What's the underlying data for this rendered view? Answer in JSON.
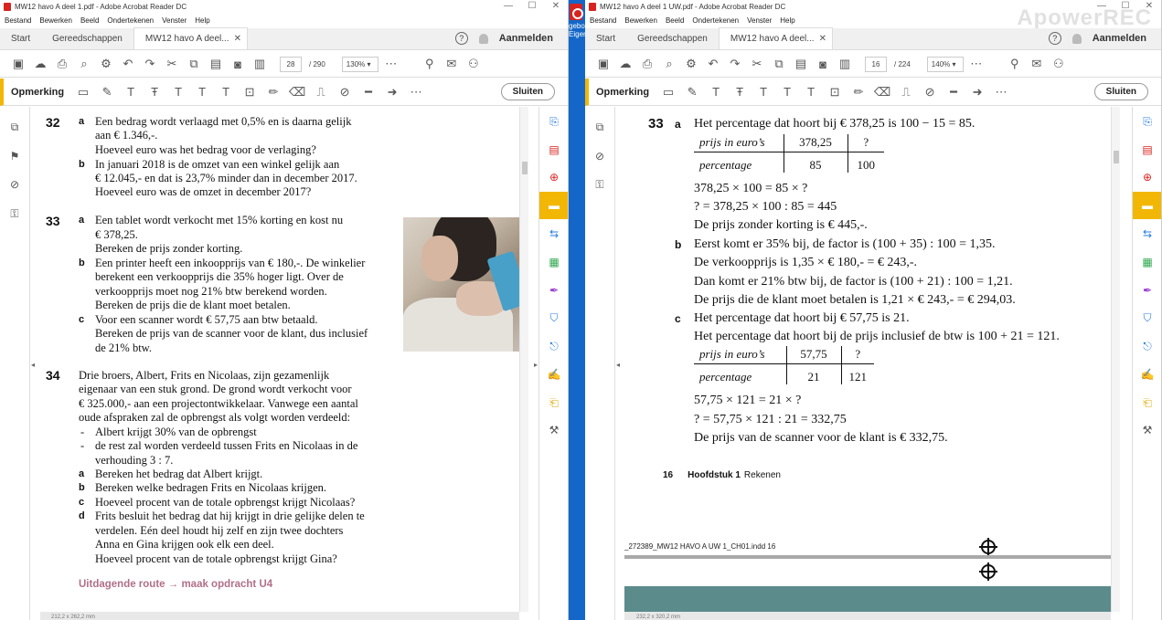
{
  "left": {
    "title": "MW12 havo A deel 1.pdf - Adobe Acrobat Reader DC",
    "menu": [
      "Bestand",
      "Bewerken",
      "Beeld",
      "Ondertekenen",
      "Venster",
      "Help"
    ],
    "tabs": {
      "start": "Start",
      "tools": "Gereedschappen",
      "doc": "MW12 havo A deel..."
    },
    "signin": "Aanmelden",
    "page_current": "28",
    "page_total": "/ 290",
    "zoom": "130%",
    "annot_label": "Opmerking",
    "close_label": "Sluiten",
    "status": "212,2 x 262,2 mm",
    "q32": {
      "num": "32",
      "a": [
        "Een bedrag wordt verlaagd met 0,5% en is daarna gelijk",
        "aan € 1.346,-.",
        "Hoeveel euro was het bedrag voor de verlaging?"
      ],
      "b": [
        "In januari 2018 is de omzet van een winkel gelijk aan",
        "€ 12.045,- en dat is 23,7% minder dan in december 2017.",
        "Hoeveel euro was de omzet in december 2017?"
      ]
    },
    "q33": {
      "num": "33",
      "a": [
        "Een tablet wordt verkocht met 15% korting en kost nu",
        "€ 378,25.",
        "Bereken de prijs zonder korting."
      ],
      "b": [
        "Een printer heeft een inkoopprijs van € 180,-. De winkelier",
        "berekent een verkoopprijs die 35% hoger ligt. Over de",
        "verkoopprijs moet nog 21% btw berekend worden.",
        "Bereken de prijs die de klant moet betalen."
      ],
      "c": [
        "Voor een scanner wordt € 57,75 aan btw betaald.",
        "Bereken de prijs van de scanner voor de klant, dus inclusief",
        "de 21% btw."
      ]
    },
    "q34": {
      "num": "34",
      "intro": [
        "Drie broers, Albert, Frits en Nicolaas, zijn gezamenlijk",
        "eigenaar van een stuk grond. De grond wordt verkocht voor",
        "€ 325.000,- aan een projectontwikkelaar. Vanwege een aantal",
        "oude afspraken zal de opbrengst als volgt worden verdeeld:"
      ],
      "bullets": [
        "Albert krijgt 30% van de opbrengst",
        "de rest zal worden verdeeld tussen Frits en Nicolaas in de",
        "verhouding 3 : 7."
      ],
      "a": "Bereken het bedrag dat Albert krijgt.",
      "b": "Bereken welke bedragen Frits en Nicolaas krijgen.",
      "c": "Hoeveel procent van de totale opbrengst krijgt Nicolaas?",
      "d": [
        "Frits besluit het bedrag dat hij krijgt in drie gelijke delen te",
        "verdelen. Eén deel houdt hij zelf en zijn twee dochters",
        "Anna en Gina krijgen ook elk een deel.",
        "Hoeveel procent van de totale opbrengst krijgt Gina?"
      ]
    },
    "route": "Uitdagende route → maak opdracht U4"
  },
  "divider_text": "gebo\nEigen",
  "right": {
    "title": "MW12 havo A deel 1 UW.pdf - Adobe Acrobat Reader DC",
    "watermark": "ApowerREC",
    "menu": [
      "Bestand",
      "Bewerken",
      "Beeld",
      "Ondertekenen",
      "Venster",
      "Help"
    ],
    "tabs": {
      "start": "Start",
      "tools": "Gereedschappen",
      "doc": "MW12 havo A deel..."
    },
    "signin": "Aanmelden",
    "page_current": "16",
    "page_total": "/ 224",
    "zoom": "140%",
    "annot_label": "Opmerking",
    "close_label": "Sluiten",
    "status": "232,2 x 320,2 mm",
    "num": "33",
    "a_line1": "Het percentage dat hoort bij € 378,25 is 100 − 15 = 85.",
    "table_a": {
      "h1": "prijs in euro’s",
      "h2": "percentage",
      "c": [
        [
          "378,25",
          "?"
        ],
        [
          "85",
          "100"
        ]
      ]
    },
    "a_calc": [
      "378,25 × 100 = 85 × ?",
      "? = 378,25 × 100 : 85 = 445",
      "De prijs zonder korting is € 445,-."
    ],
    "b_lines": [
      "Eerst komt er 35% bij, de factor is (100 + 35) : 100 = 1,35.",
      "De verkoopprijs is 1,35 × € 180,- = € 243,-.",
      "Dan komt er 21% btw bij, de factor is (100 + 21) : 100 = 1,21.",
      "De prijs die de klant moet betalen is 1,21 × € 243,- = € 294,03."
    ],
    "c_lines": [
      "Het percentage dat hoort bij € 57,75 is 21.",
      "Het percentage dat hoort bij de prijs inclusief de btw is 100 + 21 = 121."
    ],
    "table_c": {
      "h1": "prijs in euro’s",
      "h2": "percentage",
      "c": [
        [
          "57,75",
          "?"
        ],
        [
          "21",
          "121"
        ]
      ]
    },
    "c_calc": [
      "57,75 × 121 = 21 × ?",
      "? = 57,75 × 121 : 21 = 332,75",
      "De prijs van de scanner voor de klant is € 332,75."
    ],
    "footer": {
      "num": "16",
      "chapter": "Hoofdstuk 1",
      "name": "Rekenen"
    },
    "slug": "_272389_MW12 HAVO A UW 1_CH01.indd   16"
  }
}
